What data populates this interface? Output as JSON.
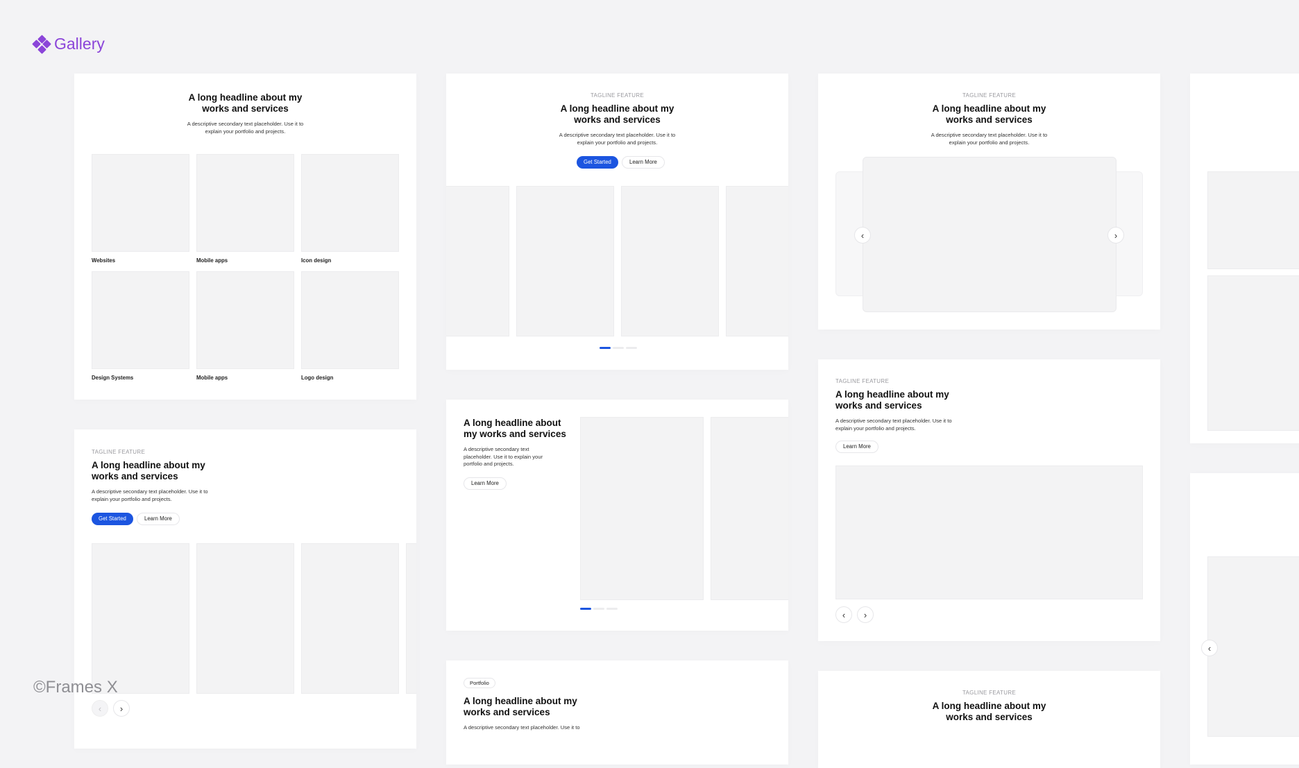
{
  "brand": {
    "title": "Gallery",
    "icon": "diamond-cluster-icon",
    "color": "#8b45d9"
  },
  "copyright": "©Frames X",
  "colors": {
    "primary": "#1c55e0",
    "placeholder": "#f3f3f4"
  },
  "card1": {
    "headline_line1": "A long headline about my",
    "headline_line2": "works and services",
    "desc_line1": "A descriptive secondary text placeholder. Use it to",
    "desc_line2": "explain your portfolio and projects.",
    "items": [
      "Websites",
      "Mobile apps",
      "Icon design",
      "Design Systems",
      "Mobile apps",
      "Logo design"
    ]
  },
  "card2": {
    "tagline": "TAGLINE FEATURE",
    "headline_line1": "A long headline about my",
    "headline_line2": "works and services",
    "desc_line1": "A descriptive secondary text placeholder. Use it to",
    "desc_line2": "explain your portfolio and projects.",
    "primary": "Get Started",
    "secondary": "Learn More"
  },
  "card3": {
    "tagline": "TAGLINE FEATURE",
    "headline_line1": "A long headline about my",
    "headline_line2": "works and services",
    "desc_line1": "A descriptive secondary text placeholder. Use it to",
    "desc_line2": "explain your portfolio and projects.",
    "prev_icon": "‹",
    "next_icon": "›"
  },
  "card4": {
    "tagline": "TAGLINE FEATURE",
    "headline_line1": "A long headline about my",
    "headline_line2": "works and services",
    "desc_line1": "A descriptive secondary text placeholder. Use it to",
    "desc_line2": "explain your portfolio and projects.",
    "primary": "Get Started",
    "secondary": "Learn More",
    "prev_icon": "‹",
    "next_icon": "›"
  },
  "card5": {
    "headline_line1": "A long headline about",
    "headline_line2": "my works and services",
    "desc_line1": "A descriptive secondary text",
    "desc_line2": "placeholder. Use it to explain your",
    "desc_line3": "portfolio and projects.",
    "secondary": "Learn More"
  },
  "card6": {
    "tagline": "TAGLINE FEATURE",
    "headline_line1": "A long headline about my",
    "headline_line2": "works and services",
    "desc_line1": "A descriptive secondary text placeholder. Use it to",
    "desc_line2": "explain your portfolio and projects.",
    "secondary": "Learn More",
    "prev_icon": "‹",
    "next_icon": "›"
  },
  "card7": {
    "badge": "Portfolio",
    "headline_line1": "A long headline about my",
    "headline_line2": "works and services",
    "desc_line1": "A descriptive secondary text placeholder. Use it to"
  },
  "card8": {
    "tagline": "TAGLINE FEATURE",
    "headline_line1": "A long headline about my",
    "headline_line2": "works and services"
  },
  "card10": {
    "prev_icon": "‹"
  }
}
